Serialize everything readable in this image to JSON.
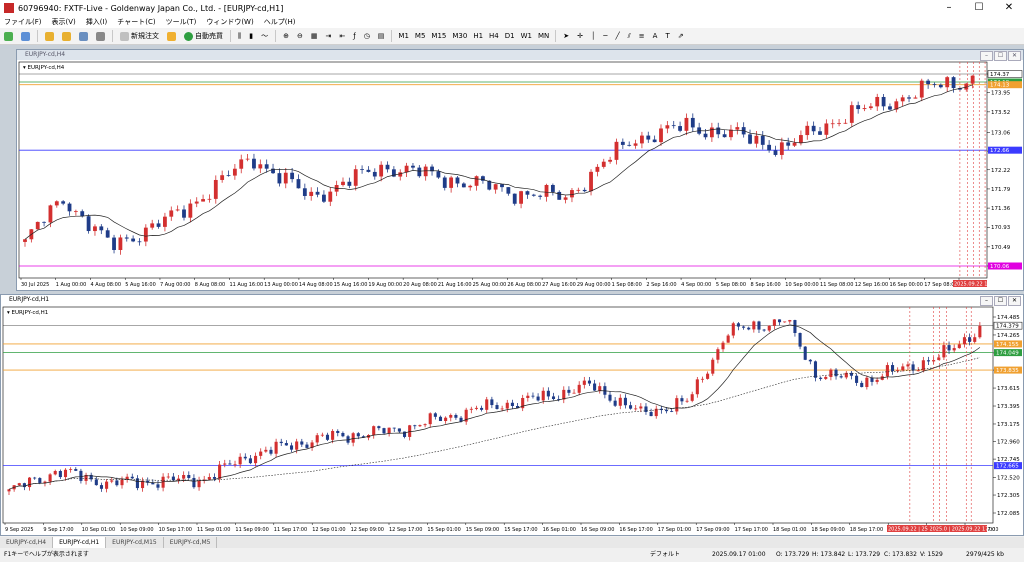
{
  "window": {
    "title": "60796940: FXTF-Live - Goldenway Japan Co., Ltd. - [EURJPY-cd,H1]",
    "min": "–",
    "max": "☐",
    "close": "✕"
  },
  "menu": [
    "ファイル(F)",
    "表示(V)",
    "挿入(I)",
    "チャート(C)",
    "ツール(T)",
    "ウィンドウ(W)",
    "ヘルプ(H)"
  ],
  "toolbar": {
    "new_order": "新規注文",
    "auto_trade": "自動売買",
    "timeframes": [
      "M1",
      "M5",
      "M15",
      "M30",
      "H1",
      "H4",
      "D1",
      "W1",
      "MN"
    ],
    "icons": [
      "new-chart-icon",
      "profiles-icon",
      "market-watch-icon",
      "navigator-icon",
      "terminal-icon",
      "tester-icon",
      "zoom-in-icon",
      "zoom-out-icon",
      "tile-icon",
      "period-icon"
    ]
  },
  "colors": {
    "bull": "#d32f2f",
    "bear": "#1f3c88",
    "ma": "#222222",
    "blueLine": "#3b3bff",
    "orange": "#f0a030",
    "green": "#2e9e40",
    "magenta": "#e000e0",
    "red": "#e04040"
  },
  "chart_top": {
    "window_title": "EURJPY-cd,H4",
    "label": "EURJPY-cd,H4",
    "y_ticks": [
      "174.37",
      "173.95",
      "173.52",
      "173.06",
      "172.64",
      "172.22",
      "171.79",
      "171.36",
      "170.93",
      "170.49",
      "170.06"
    ],
    "price_tags": [
      {
        "text": "174.37",
        "color": "#000000"
      },
      {
        "text": "174.19",
        "color": "#2e9e40"
      },
      {
        "text": "174.13",
        "color": "#f0a030"
      },
      {
        "text": "172.66",
        "color": "#3b3bff"
      },
      {
        "text": "170.06",
        "color": "#e000e0"
      }
    ],
    "x_ticks": [
      "30 Jul 2025",
      "1 Aug 00:00",
      "4 Aug 08:00",
      "5 Aug 16:00",
      "7 Aug 00:00",
      "8 Aug 08:00",
      "11 Aug 16:00",
      "13 Aug 00:00",
      "14 Aug 08:00",
      "15 Aug 16:00",
      "19 Aug 00:00",
      "20 Aug 08:00",
      "21 Aug 16:00",
      "25 Aug 00:00",
      "26 Aug 08:00",
      "27 Aug 16:00",
      "29 Aug 00:00",
      "1 Sep 08:00",
      "2 Sep 16:00",
      "4 Sep 00:00",
      "5 Sep 08:00",
      "8 Sep 16:00",
      "10 Sep 00:00",
      "11 Sep 08:00",
      "12 Sep 16:00",
      "16 Sep 00:00",
      "17 Sep 08:00",
      "18 Sep"
    ],
    "x_highlight": "2025.09.22 17:00"
  },
  "chart_bottom": {
    "window_title": "EURJPY-cd,H1",
    "label": "EURJPY-cd,H1",
    "y_ticks": [
      "174.485",
      "174.265",
      "174.045",
      "173.835",
      "173.615",
      "173.395",
      "173.175",
      "172.960",
      "172.745",
      "172.520",
      "172.305",
      "172.085"
    ],
    "price_tags": [
      {
        "text": "174.379",
        "color": "#000000"
      },
      {
        "text": "174.155",
        "color": "#f0a030"
      },
      {
        "text": "174.049",
        "color": "#2e9e40"
      },
      {
        "text": "173.835",
        "color": "#f0a030"
      },
      {
        "text": "172.665",
        "color": "#3b3bff"
      }
    ],
    "x_ticks": [
      "9 Sep 2025",
      "9 Sep 17:00",
      "10 Sep 01:00",
      "10 Sep 09:00",
      "10 Sep 17:00",
      "11 Sep 01:00",
      "11 Sep 09:00",
      "11 Sep 17:00",
      "12 Sep 01:00",
      "12 Sep 09:00",
      "12 Sep 17:00",
      "15 Sep 01:00",
      "15 Sep 09:00",
      "15 Sep 17:00",
      "16 Sep 01:00",
      "16 Sep 09:00",
      "16 Sep 17:00",
      "17 Sep 01:00",
      "17 Sep 09:00",
      "17 Sep 17:00",
      "18 Sep 01:00",
      "18 Sep 09:00",
      "18 Sep 17:00",
      "19 Sep 01:00",
      "19 Sep 09:00",
      "19 Sep 17:00"
    ],
    "x_highlight": "2025.09.22 | 25 2025.0 | 2025.09.22 17:00",
    "x_last": "00"
  },
  "tabs": [
    "EURJPY-cd,H4",
    "EURJPY-cd,H1",
    "EURJPY-cd,M15",
    "EURJPY-cd,M5"
  ],
  "status": {
    "help": "F1キーでヘルプが表示されます",
    "profile": "デフォルト",
    "datetime": "2025.09.17 01:00",
    "open": "O: 173.729",
    "high": "H: 173.842",
    "low": "L: 173.729",
    "close": "C: 173.832",
    "volume": "V: 1529",
    "traffic": "2979/425 kb"
  }
}
